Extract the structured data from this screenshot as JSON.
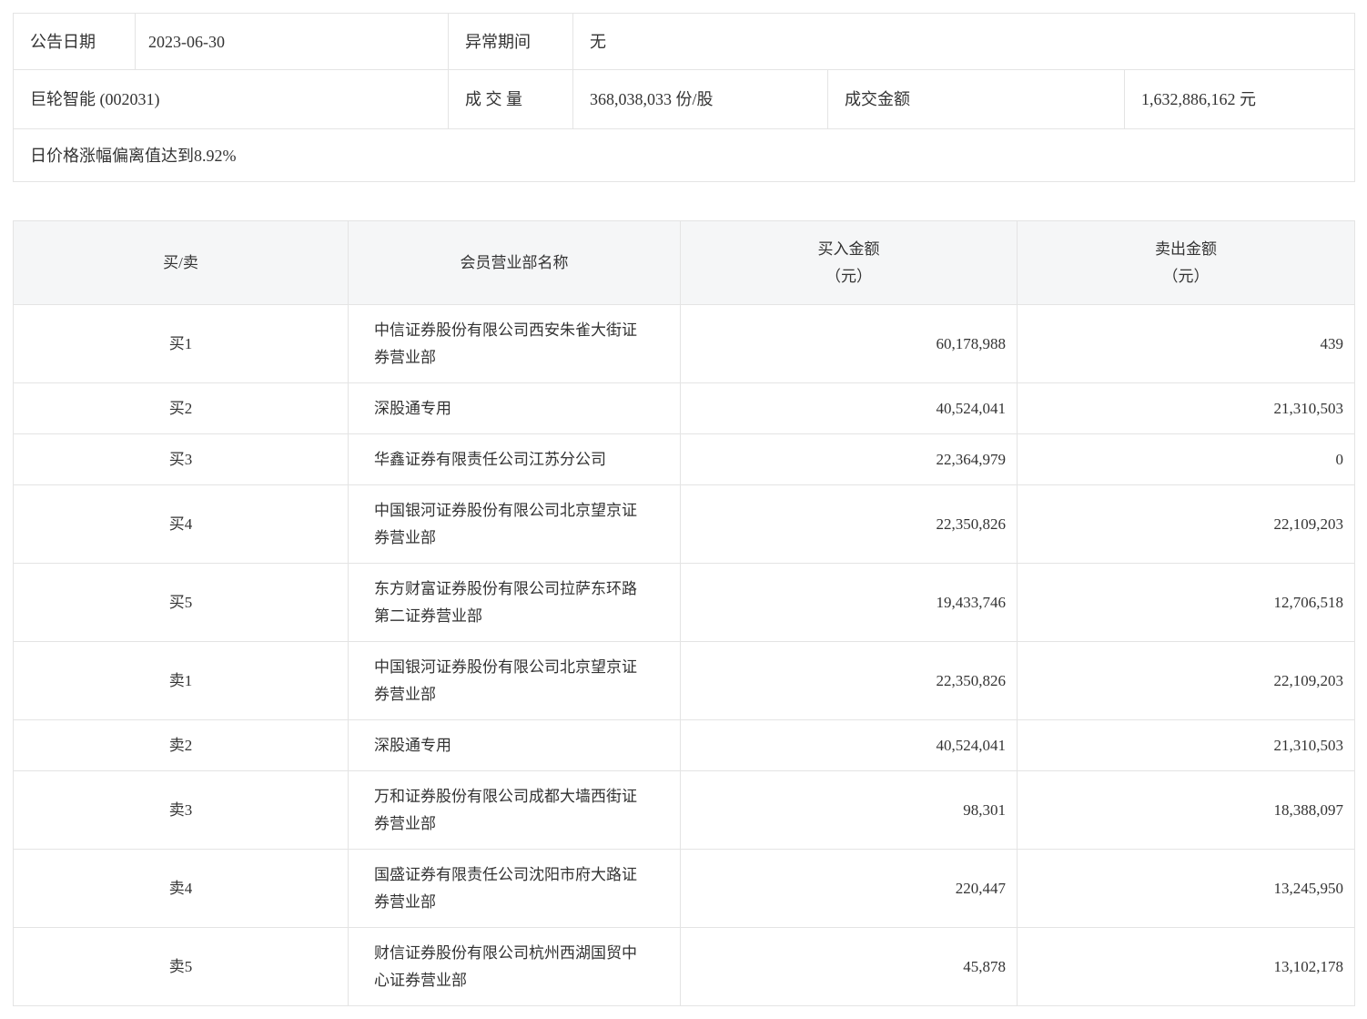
{
  "info_table": {
    "announce_date_label": "公告日期",
    "announce_date": "2023-06-30",
    "abnormal_period_label": "异常期间",
    "abnormal_period": "无",
    "stock_title": "巨轮智能 (002031)",
    "volume_label": "成 交 量",
    "volume_value": "368,038,033 份/股",
    "turnover_label": "成交金额",
    "turnover_value": "1,632,886,162 元",
    "reason_text": "日价格涨幅偏离值达到8.92%"
  },
  "broker_table": {
    "headers": {
      "side": "买/卖",
      "name": "会员营业部名称",
      "buy_line1": "买入金额",
      "buy_line2": "（元）",
      "sell_line1": "卖出金额",
      "sell_line2": "（元）"
    },
    "rows": [
      {
        "side": "买1",
        "name": "中信证券股份有限公司西安朱雀大街证券营业部",
        "buy": "60,178,988",
        "sell": "439"
      },
      {
        "side": "买2",
        "name": "深股通专用",
        "buy": "40,524,041",
        "sell": "21,310,503"
      },
      {
        "side": "买3",
        "name": "华鑫证券有限责任公司江苏分公司",
        "buy": "22,364,979",
        "sell": "0"
      },
      {
        "side": "买4",
        "name": "中国银河证券股份有限公司北京望京证券营业部",
        "buy": "22,350,826",
        "sell": "22,109,203"
      },
      {
        "side": "买5",
        "name": "东方财富证券股份有限公司拉萨东环路第二证券营业部",
        "buy": "19,433,746",
        "sell": "12,706,518"
      },
      {
        "side": "卖1",
        "name": "中国银河证券股份有限公司北京望京证券营业部",
        "buy": "22,350,826",
        "sell": "22,109,203"
      },
      {
        "side": "卖2",
        "name": "深股通专用",
        "buy": "40,524,041",
        "sell": "21,310,503"
      },
      {
        "side": "卖3",
        "name": "万和证券股份有限公司成都大墙西街证券营业部",
        "buy": "98,301",
        "sell": "18,388,097"
      },
      {
        "side": "卖4",
        "name": "国盛证券有限责任公司沈阳市府大路证券营业部",
        "buy": "220,447",
        "sell": "13,245,950"
      },
      {
        "side": "卖5",
        "name": "财信证券股份有限公司杭州西湖国贸中心证券营业部",
        "buy": "45,878",
        "sell": "13,102,178"
      }
    ]
  },
  "colors": {
    "header_background": "#f5f6f7",
    "border": "#e4e4e4",
    "text": "#333333",
    "page_background": "#ffffff"
  }
}
